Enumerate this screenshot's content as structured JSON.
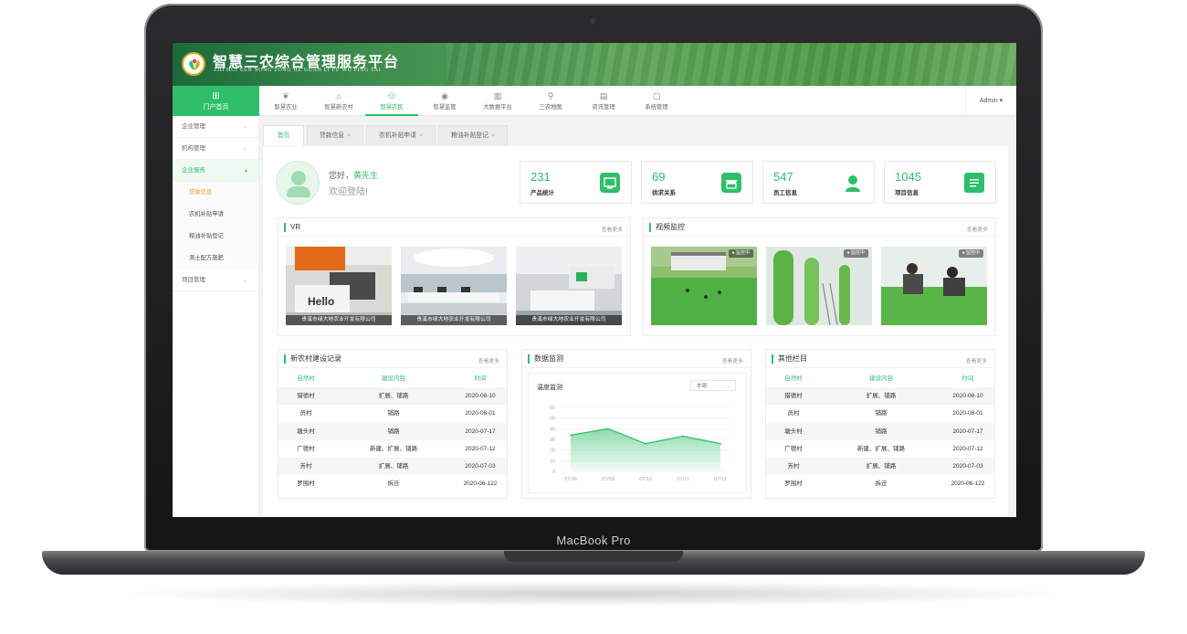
{
  "device": {
    "label": "MacBook Pro"
  },
  "app": {
    "title": "智慧三农综合管理服务平台",
    "subtitle": "ZHI HUI SAN NONG ZONG HE GUAN LI FU WU PING TAI"
  },
  "portal": {
    "label": "门户首页",
    "icon": "grid-icon"
  },
  "topnav": {
    "items": [
      {
        "label": "智慧农业",
        "icon": "sprout-icon"
      },
      {
        "label": "智慧新农村",
        "icon": "house-icon"
      },
      {
        "label": "智慧农民",
        "icon": "user-icon",
        "active": true
      },
      {
        "label": "智慧监管",
        "icon": "eye-icon"
      },
      {
        "label": "大数据平台",
        "icon": "bar-chart-icon"
      },
      {
        "label": "三农地图",
        "icon": "map-pin-icon"
      },
      {
        "label": "资讯管理",
        "icon": "news-icon"
      },
      {
        "label": "系统管理",
        "icon": "settings-icon"
      }
    ],
    "user": "Admin"
  },
  "sidebar": {
    "groups": [
      {
        "label": "企业管理"
      },
      {
        "label": "机构管理"
      },
      {
        "label": "企业服务",
        "open": true,
        "children": [
          "贷款信息",
          "农机补贴申请",
          "粮油补贴登记",
          "测土配方施肥"
        ],
        "active_child": "贷款信息"
      },
      {
        "label": "项目管理"
      }
    ]
  },
  "tabs": [
    {
      "label": "首页",
      "active": true
    },
    {
      "label": "贷款信息",
      "closable": true
    },
    {
      "label": "农机补贴申请",
      "closable": true
    },
    {
      "label": "粮油补贴登记",
      "closable": true
    }
  ],
  "welcome": {
    "greeting": "您好，",
    "name": "黄先生",
    "message": "欢迎登陆!"
  },
  "stats": [
    {
      "value": "231",
      "label": "产品统计",
      "icon": "monitor-icon"
    },
    {
      "value": "69",
      "label": "供求关系",
      "icon": "store-icon"
    },
    {
      "value": "547",
      "label": "员工信息",
      "icon": "person-icon"
    },
    {
      "value": "1045",
      "label": "项目信息",
      "icon": "document-icon"
    }
  ],
  "vr": {
    "title": "VR",
    "more": "查看更多",
    "items": [
      {
        "caption": "贵溪市绿大地农业开发有限公司",
        "scene": "orange-lobby"
      },
      {
        "caption": "贵溪市绿大地农业开发有限公司",
        "scene": "office"
      },
      {
        "caption": "贵溪市绿大地农业开发有限公司",
        "scene": "reception"
      }
    ]
  },
  "video": {
    "title": "视频监控",
    "more": "查看更多",
    "items": [
      {
        "badge": "监控中",
        "scene": "field"
      },
      {
        "badge": "监控中",
        "scene": "greenhouse-columns"
      },
      {
        "badge": "监控中",
        "scene": "workers"
      }
    ]
  },
  "records": {
    "title": "新农村建设记录",
    "more": "查看更多",
    "columns": [
      "自然村",
      "建设内容",
      "时间"
    ],
    "rows": [
      [
        "猎德村",
        "扩展、铺路",
        "2020-08-10"
      ],
      [
        "员村",
        "铺路",
        "2020-08-01"
      ],
      [
        "塘头村",
        "铺路",
        "2020-07-17"
      ],
      [
        "广德村",
        "新建、扩展、铺路",
        "2020-07-12"
      ],
      [
        "芳村",
        "扩展、铺路",
        "2020-07-03"
      ],
      [
        "罗围村",
        "拆迁",
        "2020-06-122"
      ]
    ]
  },
  "monitor": {
    "title": "数据监测",
    "more": "查看更多",
    "chart_title": "温度监测",
    "range": "本周"
  },
  "chart_data": {
    "type": "area",
    "title": "温度监测",
    "categories": [
      "07/08",
      "07/09",
      "07/10",
      "07/11",
      "07/12"
    ],
    "values": [
      34,
      40,
      26,
      33,
      26
    ],
    "yticks": [
      0,
      10,
      20,
      30,
      40,
      50,
      60
    ],
    "ylim": [
      0,
      60
    ],
    "grid": true,
    "color": "#2fbf6a"
  },
  "other": {
    "title": "其他栏目",
    "more": "查看更多",
    "columns": [
      "自然村",
      "建设内容",
      "时间"
    ],
    "rows": [
      [
        "猎德村",
        "扩展、铺路",
        "2020-08-10"
      ],
      [
        "员村",
        "铺路",
        "2020-08-01"
      ],
      [
        "塘头村",
        "铺路",
        "2020-07-17"
      ],
      [
        "广德村",
        "新建、扩展、铺路",
        "2020-07-12"
      ],
      [
        "芳村",
        "扩展、铺路",
        "2020-07-03"
      ],
      [
        "罗围村",
        "拆迁",
        "2020-06-122"
      ]
    ]
  },
  "colors": {
    "accent": "#2fbf6a",
    "warning": "#f0a020"
  }
}
